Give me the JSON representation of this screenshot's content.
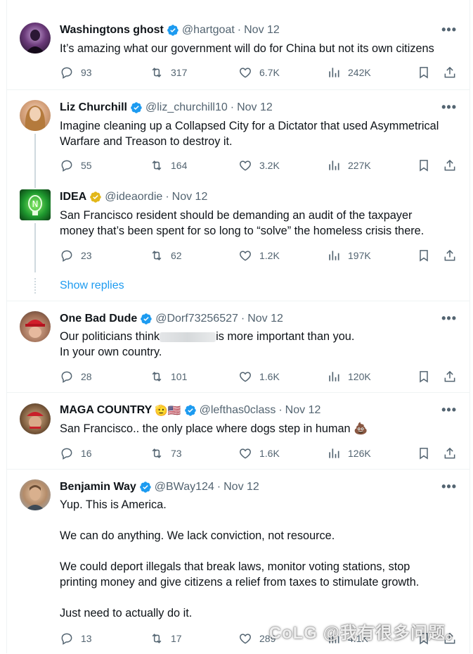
{
  "colors": {
    "accent": "#1d9bf0",
    "gold": "#e2b719",
    "text": "#0f1419",
    "muted": "#536471"
  },
  "tweets": [
    {
      "name": "Washingtons ghost",
      "handle": "@hartgoat",
      "date": "Nov 12",
      "badge": "blue",
      "lines": [
        "It’s amazing what our government will do for China but not its own citizens"
      ],
      "replies": "93",
      "reposts": "317",
      "likes": "6.7K",
      "views": "242K"
    },
    {
      "name": "Liz Churchill",
      "handle": "@liz_churchill10",
      "date": "Nov 12",
      "badge": "blue",
      "lines": [
        "Imagine cleaning up a Collapsed City for a Dictator that used Asymmetrical",
        "Warfare and Treason to destroy it."
      ],
      "replies": "55",
      "reposts": "164",
      "likes": "3.2K",
      "views": "227K"
    },
    {
      "name": "IDEA",
      "handle": "@ideaordie",
      "date": "Nov 12",
      "badge": "gold",
      "lines": [
        "San Francisco resident should be demanding an audit of the taxpayer",
        "money that’s been spent for so long to “solve” the homeless crisis there."
      ],
      "replies": "23",
      "reposts": "62",
      "likes": "1.2K",
      "views": "197K"
    },
    {
      "name": "One Bad Dude",
      "handle": "@Dorf73256527",
      "date": "Nov 12",
      "badge": "blue",
      "line1_before": "Our politicians think",
      "line1_after": "is more important than you.",
      "line2": "In your own country.",
      "replies": "28",
      "reposts": "101",
      "likes": "1.6K",
      "views": "120K"
    },
    {
      "name": "MAGA COUNTRY",
      "handle": "@lefthas0class",
      "date": "Nov 12",
      "badge": "blue",
      "name_emoji": "🫡🇺🇸",
      "lines": [
        "San Francisco.. the only place where dogs step in human 💩"
      ],
      "replies": "16",
      "reposts": "73",
      "likes": "1.6K",
      "views": "126K"
    },
    {
      "name": "Benjamin Way",
      "handle": "@BWay124",
      "date": "Nov 12",
      "badge": "blue",
      "lines": [
        "Yup. This is America.",
        "",
        "We can do anything. We lack conviction, not resource.",
        "",
        "We could deport illegals that break laws, monitor voting stations, stop",
        "printing money and give citizens a relief from taxes to stimulate growth.",
        "",
        "Just need to actually do it."
      ],
      "replies": "13",
      "reposts": "17",
      "likes": "289",
      "views": "4.1K"
    }
  ],
  "show_replies": "Show replies",
  "more_label": "•••",
  "dot_sep": "·",
  "watermark": "CoLG @我有很多问题。"
}
